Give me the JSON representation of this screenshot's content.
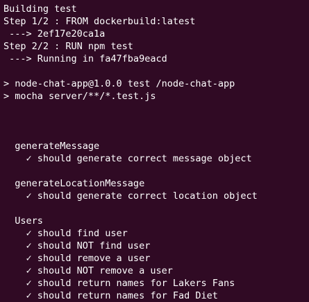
{
  "terminal": {
    "background_color": "#300a24",
    "text_color": "#ffffff",
    "lines": [
      "Building test",
      "Step 1/2 : FROM dockerbuild:latest",
      " ---> 2ef17e20ca1a",
      "Step 2/2 : RUN npm test",
      " ---> Running in fa47fba9eacd",
      "",
      "> node-chat-app@1.0.0 test /node-chat-app",
      "> mocha server/**/*.test.js",
      "",
      "",
      "",
      "  generateMessage",
      "    ✓ should generate correct message object",
      "",
      "  generateLocationMessage",
      "    ✓ should generate correct location object",
      "",
      "  Users",
      "    ✓ should find user",
      "    ✓ should NOT find user",
      "    ✓ should remove a user",
      "    ✓ should NOT remove a user",
      "    ✓ should return names for Lakers Fans",
      "    ✓ should return names for Fad Diet"
    ]
  }
}
